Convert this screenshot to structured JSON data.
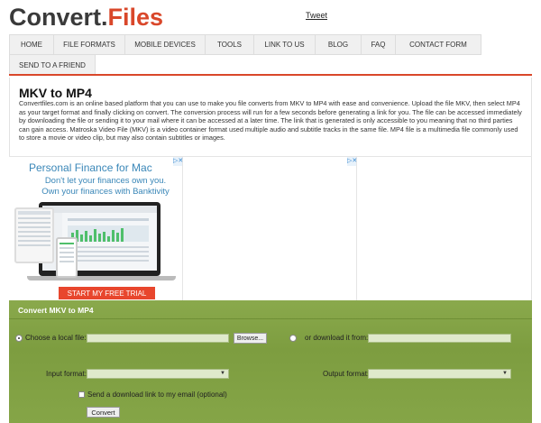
{
  "header": {
    "logo_part1": "Convert.",
    "logo_part2": "Files",
    "tweet": "Tweet"
  },
  "nav": {
    "row1": [
      "HOME",
      "FILE FORMATS",
      "MOBILE DEVICES",
      "TOOLS",
      "LINK TO US",
      "BLOG",
      "FAQ",
      "CONTACT FORM"
    ],
    "row2": [
      "SEND TO A FRIEND"
    ]
  },
  "page": {
    "title": "MKV to MP4",
    "description": "Convertfiles.com is an online based platform that you can use to make you file converts from MKV to MP4 with ease and convenience. Upload the file MKV, then select MP4 as your target format and finally clicking on convert. The conversion process will run for a few seconds before generating a link for you. The file can be accessed immediately by downloading the file or sending it to your mail where it can be accessed at a later time. The link that is generated is only accessible to you meaning that no third parties can gain access. Matroska Video File (MKV) is a video container format used multiple audio and subtitle tracks in the same file. MP4 file is a multimedia file commonly used to store a movie or video clip, but may also contain subtitles or images."
  },
  "ad": {
    "headline": "Personal Finance for Mac",
    "line1": "Don't let your finances own you.",
    "line2": "Own your finances with Banktivity",
    "cta": "START MY FREE TRIAL",
    "adchoices_glyph": "▷✕"
  },
  "converter": {
    "title": "Convert MKV to MP4",
    "local_file_label": "Choose a local file:",
    "browse_label": "Browse...",
    "download_label": "or download it from:",
    "input_format_label": "Input format:",
    "output_format_label": "Output format:",
    "send_link_label": "Send a download link to my email (optional)",
    "convert_label": "Convert"
  },
  "colors": {
    "brand": "#d9472a",
    "panel_green": "#85a547",
    "ad_blue": "#3a87b8"
  }
}
